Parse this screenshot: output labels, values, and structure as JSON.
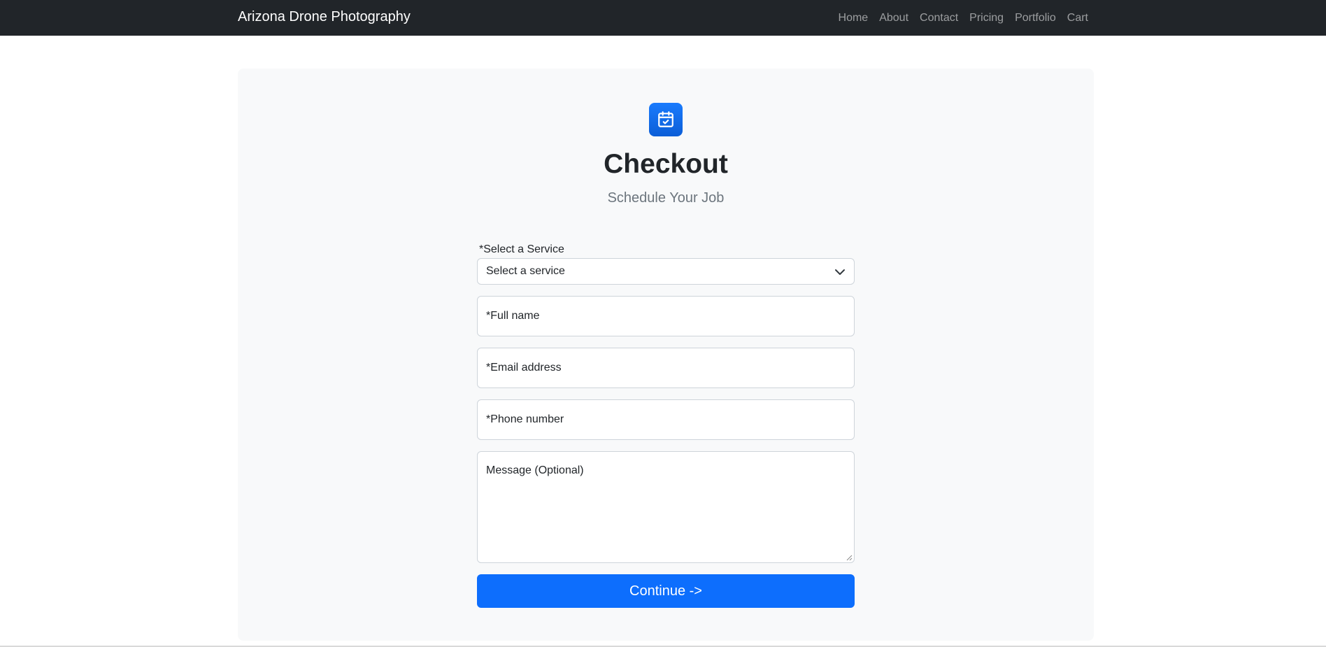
{
  "navbar": {
    "brand": "Arizona Drone Photography",
    "links": [
      "Home",
      "About",
      "Contact",
      "Pricing",
      "Portfolio",
      "Cart"
    ]
  },
  "checkout": {
    "icon": "calendar-check-icon",
    "title": "Checkout",
    "subtitle": "Schedule Your Job",
    "service_label": "*Select a Service",
    "service_selected": "Select a service",
    "full_name_placeholder": "*Full name",
    "email_placeholder": "*Email address",
    "phone_placeholder": "*Phone number",
    "message_placeholder": "Message (Optional)",
    "continue_label": "Continue ->"
  },
  "colors": {
    "navbar_bg": "#212529",
    "panel_bg": "#f8f9fa",
    "primary": "#0d6efd",
    "muted_text": "#6c757d"
  }
}
